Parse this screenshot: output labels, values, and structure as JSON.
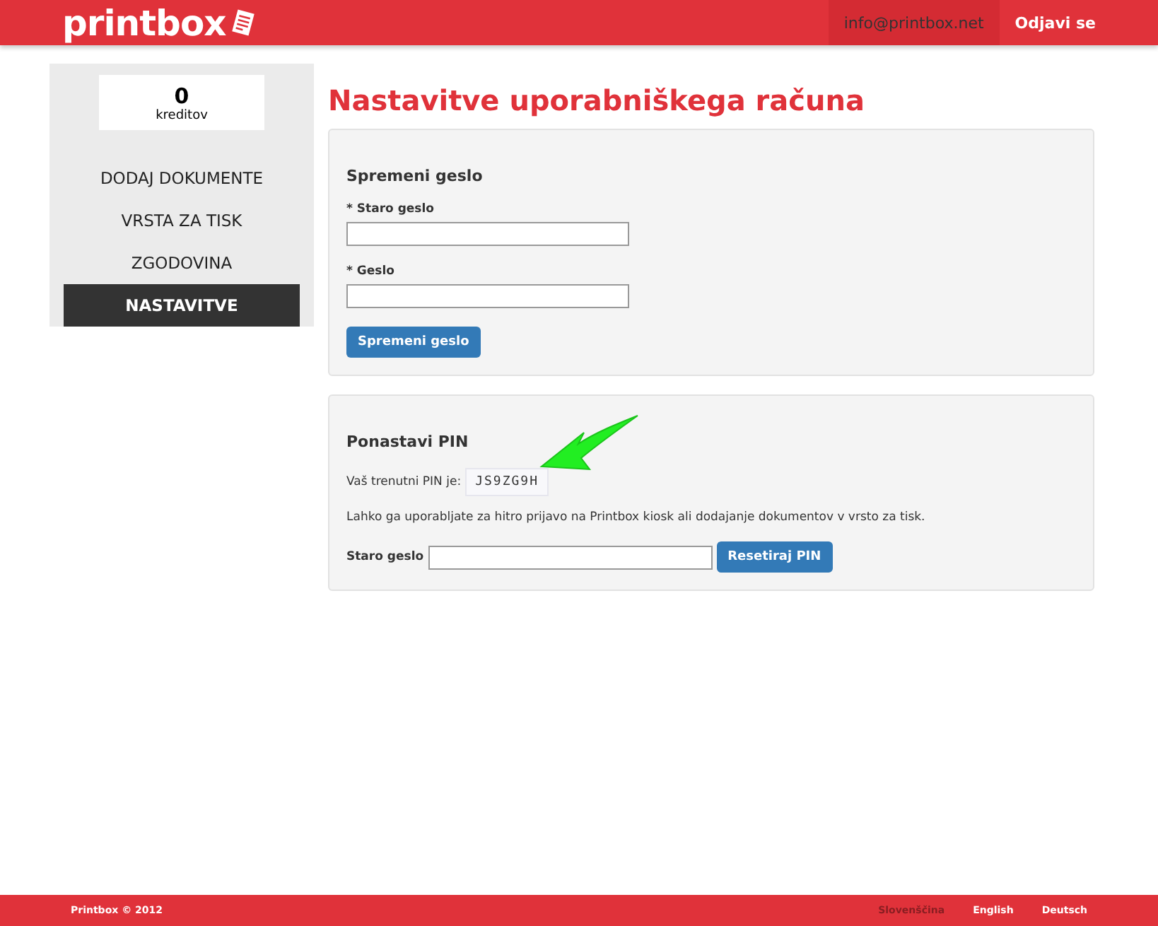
{
  "header": {
    "logo": "printbox",
    "email": "info@printbox.net",
    "logout": "Odjavi se"
  },
  "sidebar": {
    "credits": "0",
    "credits_label": "kreditov",
    "items": [
      {
        "label": "DODAJ DOKUMENTE",
        "selected": false
      },
      {
        "label": "VRSTA ZA TISK",
        "selected": false
      },
      {
        "label": "ZGODOVINA",
        "selected": false
      },
      {
        "label": "NASTAVITVE",
        "selected": true
      }
    ]
  },
  "title": "Nastavitve uporabniškega računa",
  "password_panel": {
    "heading": "Spremeni geslo",
    "fields": [
      {
        "label": "* Staro geslo"
      },
      {
        "label": "* Geslo"
      }
    ],
    "button": "Spremeni geslo"
  },
  "pin_panel": {
    "heading": "Ponastavi PIN",
    "pin_label": "Vaš trenutni PIN je:",
    "pin": "JS9ZG9H",
    "note": "Lahko ga uporabljate za hitro prijavo na Printbox kiosk ali dodajanje dokumentov v vrsto za tisk.",
    "field_label": "Staro geslo",
    "button": "Resetiraj PIN"
  },
  "footer": {
    "copyright": "Printbox © 2012",
    "languages": [
      {
        "label": "Slovenščina",
        "selected": true
      },
      {
        "label": "English",
        "selected": false
      },
      {
        "label": "Deutsch",
        "selected": false
      }
    ]
  }
}
